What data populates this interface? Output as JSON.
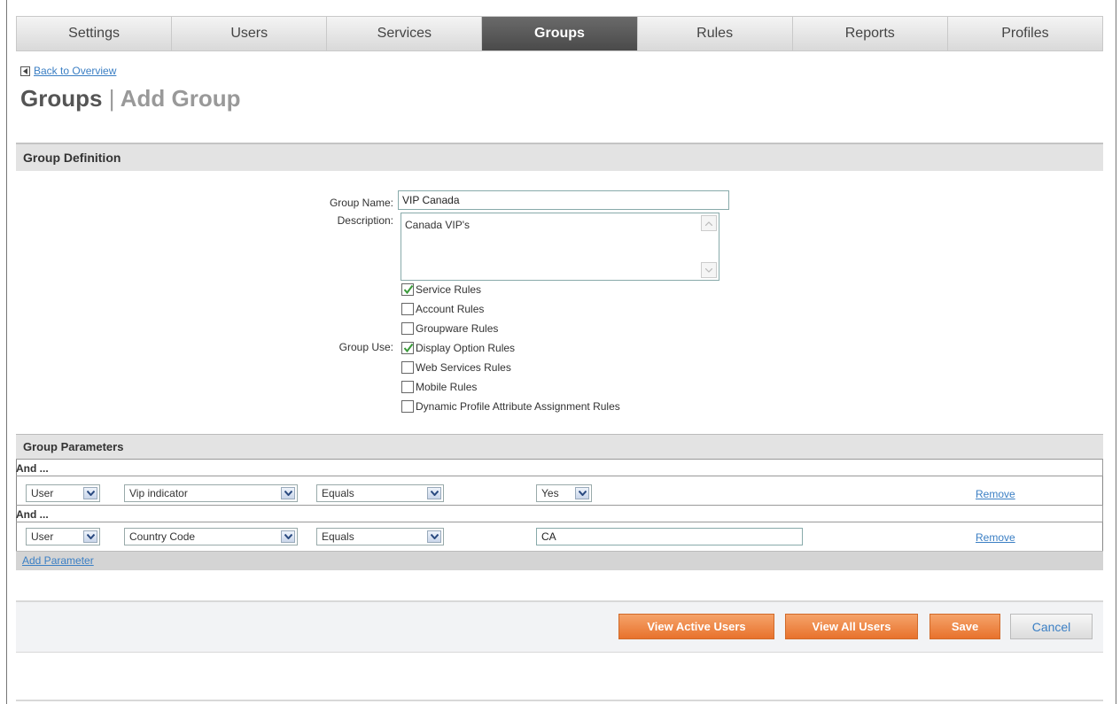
{
  "tabs": [
    {
      "label": "Settings",
      "active": false
    },
    {
      "label": "Users",
      "active": false
    },
    {
      "label": "Services",
      "active": false
    },
    {
      "label": "Groups",
      "active": true
    },
    {
      "label": "Rules",
      "active": false
    },
    {
      "label": "Reports",
      "active": false
    },
    {
      "label": "Profiles",
      "active": false
    }
  ],
  "back_link": "Back to Overview",
  "page_title": {
    "main": "Groups",
    "sep": "|",
    "sub": "Add Group"
  },
  "group_definition": {
    "heading": "Group Definition",
    "group_name_label": "Group Name:",
    "group_name_value": "VIP Canada",
    "description_label": "Description:",
    "description_value": "Canada VIP's",
    "group_use_label": "Group Use:",
    "group_use_options": [
      {
        "label": "Service Rules",
        "checked": true
      },
      {
        "label": "Account Rules",
        "checked": false
      },
      {
        "label": "Groupware Rules",
        "checked": false
      },
      {
        "label": "Display Option Rules",
        "checked": true
      },
      {
        "label": "Web Services Rules",
        "checked": false
      },
      {
        "label": "Mobile Rules",
        "checked": false
      },
      {
        "label": "Dynamic Profile Attribute Assignment Rules",
        "checked": false
      }
    ]
  },
  "group_parameters": {
    "heading": "Group Parameters",
    "and_label": "And ...",
    "rows": [
      {
        "source": "User",
        "attribute": "Vip indicator",
        "operator": "Equals",
        "value": "Yes",
        "value_type": "select",
        "remove": "Remove"
      },
      {
        "source": "User",
        "attribute": "Country Code",
        "operator": "Equals",
        "value": "CA",
        "value_type": "text",
        "remove": "Remove"
      }
    ],
    "add_parameter": "Add Parameter"
  },
  "buttons": {
    "view_active_users": "View Active Users",
    "view_all_users": "View All Users",
    "save": "Save",
    "cancel": "Cancel"
  },
  "colors": {
    "accent_orange": "#e8722c",
    "link_blue": "#3b7fc4",
    "active_tab": "#555555"
  }
}
